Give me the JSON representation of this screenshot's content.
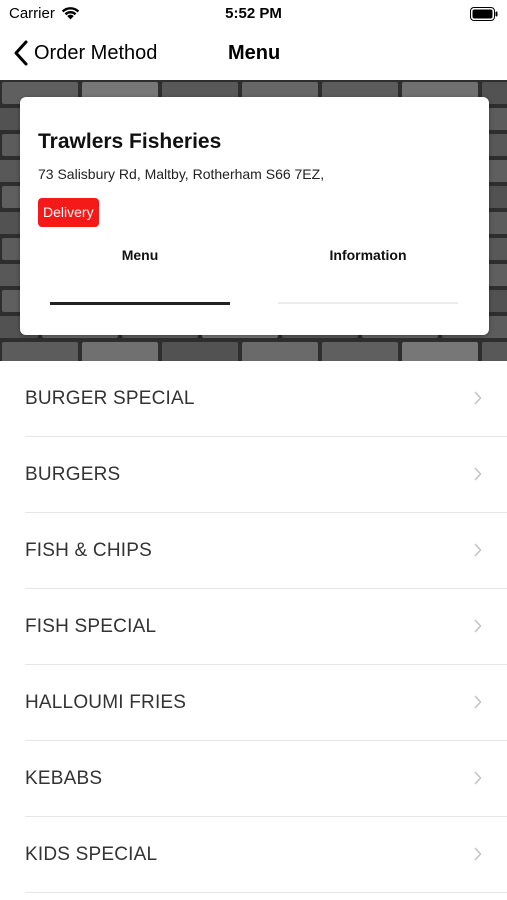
{
  "status_bar": {
    "carrier": "Carrier",
    "time": "5:52 PM"
  },
  "nav": {
    "back_label": "Order Method",
    "title": "Menu"
  },
  "restaurant": {
    "name": "Trawlers Fisheries",
    "address": "73 Salisbury Rd, Maltby, Rotherham S66 7EZ,",
    "badge": "Delivery",
    "badge_color": "#f41a1a"
  },
  "tabs": [
    {
      "label": "Menu",
      "active": true
    },
    {
      "label": "Information",
      "active": false
    }
  ],
  "categories": [
    {
      "label": "BURGER SPECIAL"
    },
    {
      "label": "BURGERS"
    },
    {
      "label": "FISH & CHIPS"
    },
    {
      "label": "FISH SPECIAL"
    },
    {
      "label": "HALLOUMI FRIES"
    },
    {
      "label": "KEBABS"
    },
    {
      "label": "KIDS SPECIAL"
    }
  ]
}
